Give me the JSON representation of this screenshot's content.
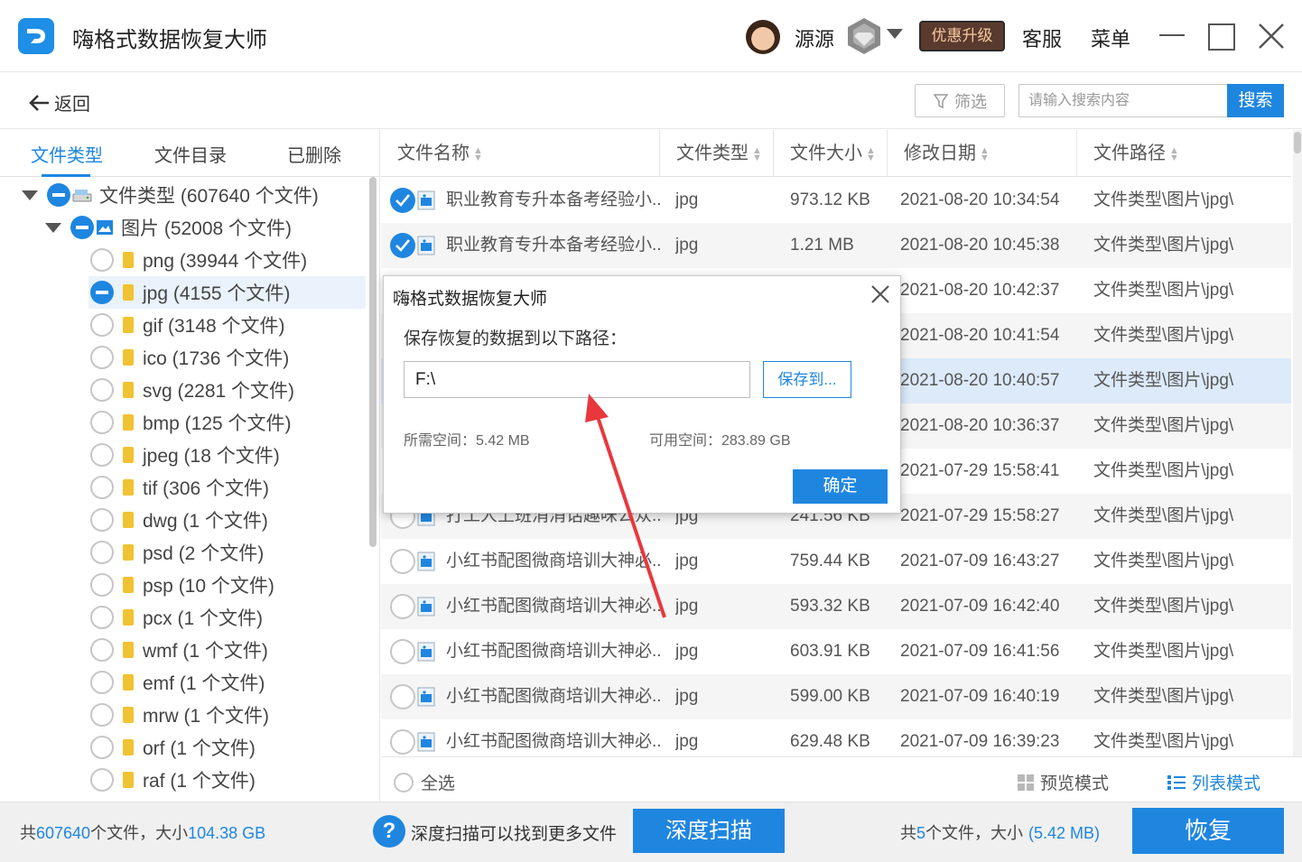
{
  "window": {
    "title": "嗨格式数据恢复大师",
    "username": "源源",
    "upgrade_label": "优惠升级",
    "service_label": "客服",
    "menu_label": "菜单"
  },
  "toolbar": {
    "back_label": "返回",
    "filter_label": "筛选",
    "search_placeholder": "请输入搜索内容",
    "search_label": "搜索"
  },
  "tabs": [
    {
      "label": "文件类型",
      "active": true
    },
    {
      "label": "文件目录",
      "active": false
    },
    {
      "label": "已删除",
      "active": false
    }
  ],
  "tree": {
    "root": {
      "label": "文件类型 (607640 个文件)",
      "icon": "drive-icon"
    },
    "category": {
      "label": "图片 (52008 个文件)",
      "icon": "image-icon"
    },
    "items": [
      {
        "label": "png (39944 个文件)",
        "state": "unchecked"
      },
      {
        "label": "jpg (4155 个文件)",
        "state": "partial",
        "selected": true
      },
      {
        "label": "gif (3148 个文件)",
        "state": "unchecked"
      },
      {
        "label": "ico (1736 个文件)",
        "state": "unchecked"
      },
      {
        "label": "svg (2281 个文件)",
        "state": "unchecked"
      },
      {
        "label": "bmp (125 个文件)",
        "state": "unchecked"
      },
      {
        "label": "jpeg (18 个文件)",
        "state": "unchecked"
      },
      {
        "label": "tif (306 个文件)",
        "state": "unchecked"
      },
      {
        "label": "dwg (1 个文件)",
        "state": "unchecked"
      },
      {
        "label": "psd (2 个文件)",
        "state": "unchecked"
      },
      {
        "label": "psp (10 个文件)",
        "state": "unchecked"
      },
      {
        "label": "pcx (1 个文件)",
        "state": "unchecked"
      },
      {
        "label": "wmf (1 个文件)",
        "state": "unchecked"
      },
      {
        "label": "emf (1 个文件)",
        "state": "unchecked"
      },
      {
        "label": "mrw (1 个文件)",
        "state": "unchecked"
      },
      {
        "label": "orf (1 个文件)",
        "state": "unchecked"
      },
      {
        "label": "raf (1 个文件)",
        "state": "unchecked"
      }
    ]
  },
  "table": {
    "columns": [
      "文件名称",
      "文件类型",
      "文件大小",
      "修改日期",
      "文件路径"
    ],
    "rows": [
      {
        "checked": true,
        "name": "职业教育专升本备考经验小...",
        "type": "jpg",
        "size": "973.12 KB",
        "date": "2021-08-20 10:34:54",
        "path": "文件类型\\图片\\jpg\\"
      },
      {
        "checked": true,
        "name": "职业教育专升本备考经验小...",
        "type": "jpg",
        "size": "1.21 MB",
        "date": "2021-08-20 10:45:38",
        "path": "文件类型\\图片\\jpg\\"
      },
      {
        "checked": true,
        "name": "",
        "type": "",
        "size": "",
        "date": "2021-08-20 10:42:37",
        "path": "文件类型\\图片\\jpg\\"
      },
      {
        "checked": true,
        "name": "",
        "type": "",
        "size": "",
        "date": "2021-08-20 10:41:54",
        "path": "文件类型\\图片\\jpg\\"
      },
      {
        "checked": true,
        "name": "",
        "type": "",
        "size": "",
        "date": "2021-08-20 10:40:57",
        "path": "文件类型\\图片\\jpg\\",
        "highlight": true
      },
      {
        "checked": false,
        "name": "",
        "type": "",
        "size": "",
        "date": "2021-08-20 10:36:37",
        "path": "文件类型\\图片\\jpg\\"
      },
      {
        "checked": false,
        "name": "",
        "type": "",
        "size": "",
        "date": "2021-07-29 15:58:41",
        "path": "文件类型\\图片\\jpg\\"
      },
      {
        "checked": false,
        "name": "打工人上班消消话趣味公众...",
        "type": "jpg",
        "size": "241.56 KB",
        "date": "2021-07-29 15:58:27",
        "path": "文件类型\\图片\\jpg\\"
      },
      {
        "checked": false,
        "name": "小红书配图微商培训大神必...",
        "type": "jpg",
        "size": "759.44 KB",
        "date": "2021-07-09 16:43:27",
        "path": "文件类型\\图片\\jpg\\"
      },
      {
        "checked": false,
        "name": "小红书配图微商培训大神必...",
        "type": "jpg",
        "size": "593.32 KB",
        "date": "2021-07-09 16:42:40",
        "path": "文件类型\\图片\\jpg\\"
      },
      {
        "checked": false,
        "name": "小红书配图微商培训大神必...",
        "type": "jpg",
        "size": "603.91 KB",
        "date": "2021-07-09 16:41:56",
        "path": "文件类型\\图片\\jpg\\"
      },
      {
        "checked": false,
        "name": "小红书配图微商培训大神必...",
        "type": "jpg",
        "size": "599.00 KB",
        "date": "2021-07-09 16:40:19",
        "path": "文件类型\\图片\\jpg\\"
      },
      {
        "checked": false,
        "name": "小红书配图微商培训大神必...",
        "type": "jpg",
        "size": "629.48 KB",
        "date": "2021-07-09 16:39:23",
        "path": "文件类型\\图片\\jpg\\"
      }
    ]
  },
  "table_footer": {
    "select_all_label": "全选",
    "preview_mode_label": "预览模式",
    "list_mode_label": "列表模式"
  },
  "statusbar": {
    "total_prefix": "共",
    "total_files": "607640",
    "total_mid": "个文件，大小",
    "total_size": "104.38 GB",
    "hint": "深度扫描可以找到更多文件",
    "deep_scan_label": "深度扫描",
    "selected_prefix": "共",
    "selected_count": "5",
    "selected_mid": "个文件，大小",
    "selected_size": "(5.42 MB)",
    "recover_label": "恢复"
  },
  "dialog": {
    "title": "嗨格式数据恢复大师",
    "label": "保存恢复的数据到以下路径：",
    "path_value": "F:\\",
    "save_to_label": "保存到...",
    "need_space": "所需空间：5.42 MB",
    "available_space": "可用空间：283.89 GB",
    "ok_label": "确定"
  },
  "colors": {
    "accent": "#1f86e0",
    "annotation_arrow": "#e8383d"
  }
}
